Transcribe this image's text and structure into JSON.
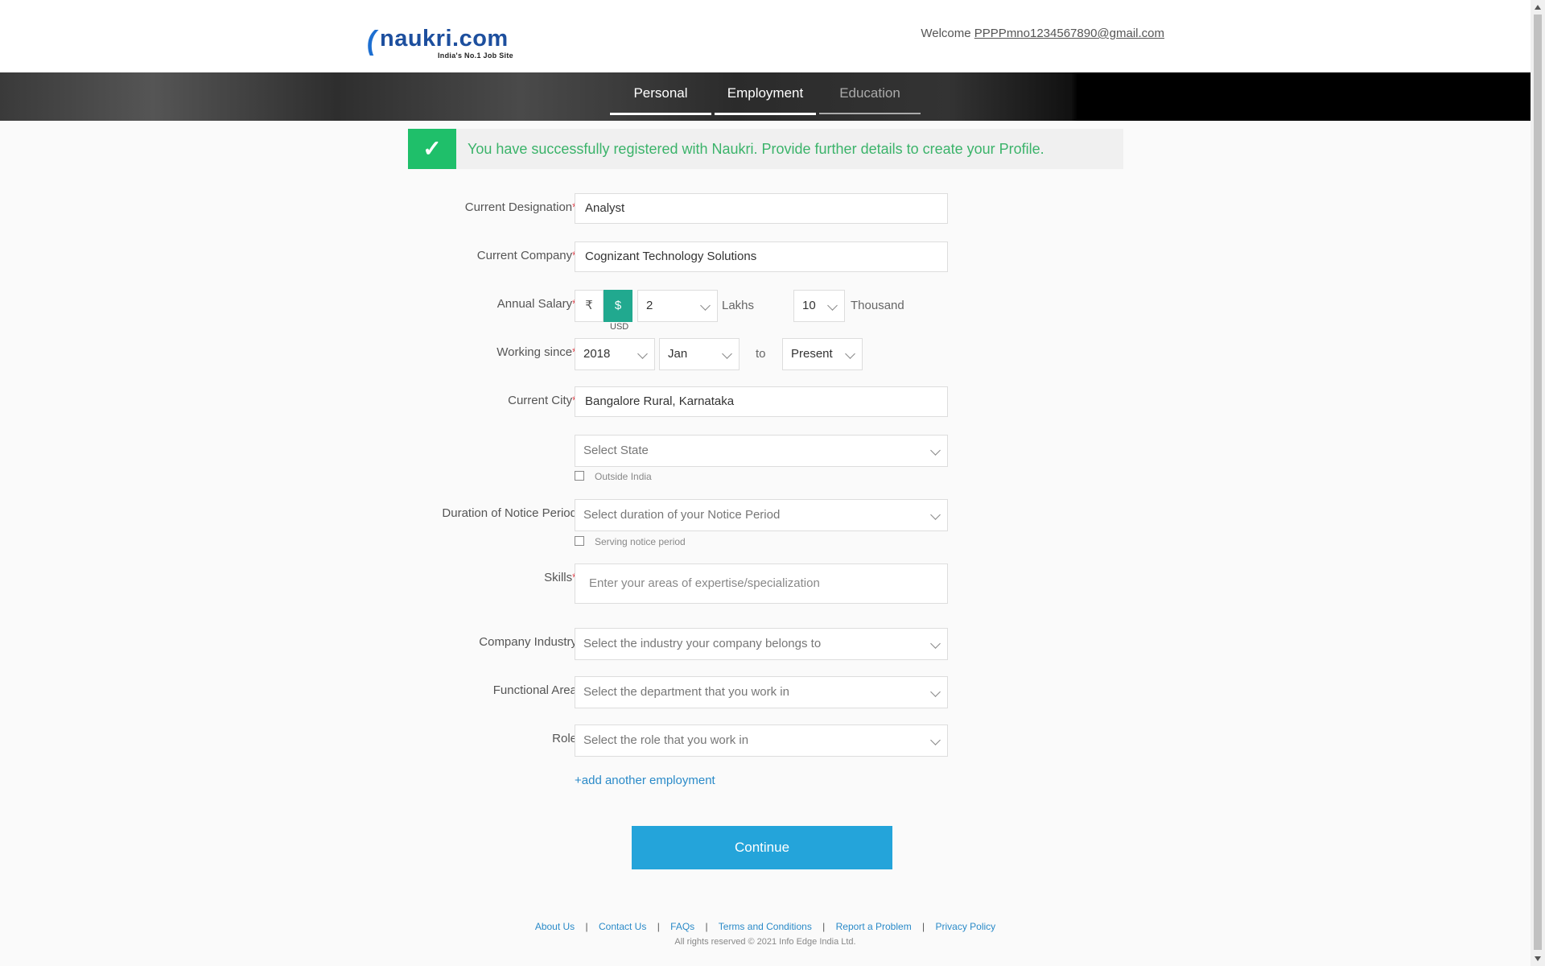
{
  "header": {
    "logo_mark": "(",
    "logo_text": "naukri.com",
    "logo_tagline": "India's No.1 Job Site",
    "welcome_label": "Welcome",
    "user_email": "PPPPmno1234567890@gmail.com"
  },
  "tabs": [
    {
      "label": "Personal",
      "state": "complete"
    },
    {
      "label": "Employment",
      "state": "active"
    },
    {
      "label": "Education",
      "state": "inactive"
    }
  ],
  "success": {
    "icon": "check-icon",
    "message": "You have successfully registered with Naukri. Provide further details to create your Profile."
  },
  "form": {
    "designation": {
      "label": "Current Designation",
      "required": "*",
      "value": "Analyst"
    },
    "company": {
      "label": "Current Company",
      "required": "*",
      "value": "Cognizant Technology Solutions"
    },
    "salary": {
      "label": "Annual Salary",
      "required": "*",
      "currency_inr": "₹",
      "currency_usd": "$",
      "currency_caption": "USD",
      "lakhs_value": "2",
      "lakhs_unit": "Lakhs",
      "thousand_value": "10",
      "thousand_unit": "Thousand"
    },
    "working_since": {
      "label": "Working since",
      "required": "*",
      "year": "2018",
      "month": "Jan",
      "to_label": "to",
      "end": "Present"
    },
    "city": {
      "label": "Current City",
      "required": "*",
      "value": "Bangalore Rural, Karnataka"
    },
    "state": {
      "placeholder": "Select State",
      "checkbox_label": "Outside India"
    },
    "notice": {
      "label": "Duration of Notice Period",
      "placeholder": "Select duration of your Notice Period",
      "checkbox_label": "Serving notice period"
    },
    "skills": {
      "label": "Skills",
      "required": "*",
      "placeholder": "Enter your areas of expertise/specialization"
    },
    "industry": {
      "label": "Company Industry",
      "placeholder": "Select the industry your company belongs to"
    },
    "functional_area": {
      "label": "Functional Area",
      "placeholder": "Select the department that you work in"
    },
    "role": {
      "label": "Role",
      "placeholder": "Select the role that you work in"
    },
    "add_employment": "+add another employment",
    "continue_label": "Continue"
  },
  "footer": {
    "links": [
      "About Us",
      "Contact Us",
      "FAQs",
      "Terms and Conditions",
      "Report a Problem",
      "Privacy Policy"
    ],
    "separator": "|",
    "copyright": "All rights reserved © 2021 Info Edge India Ltd."
  },
  "colors": {
    "accent_green": "#1fbf6a",
    "usd_active": "#21a98f",
    "button_blue": "#24a4da",
    "link_blue": "#2a8ac8",
    "required_red": "#e0303a"
  }
}
